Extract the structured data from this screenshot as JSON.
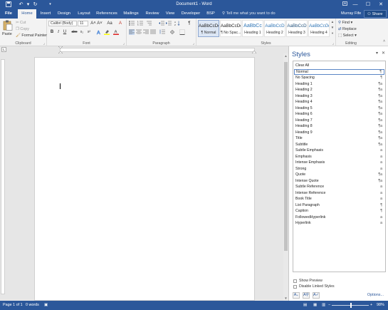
{
  "titlebar": {
    "title": "Document1 - Word",
    "save_icon": "save-icon",
    "undo_icon": "undo-icon",
    "redo_icon": "redo-icon",
    "customize_icon": "customize-qat-icon",
    "ribbon_display_icon": "ribbon-display-options-icon",
    "minimize": "—",
    "maximize": "☐",
    "close": "✕"
  },
  "tabs": {
    "file": "File",
    "items": [
      "Home",
      "Insert",
      "Design",
      "Layout",
      "References",
      "Mailings",
      "Review",
      "View",
      "Developer",
      "BSP"
    ],
    "active": "Home",
    "tell_me": "Tell me what you want to do",
    "user": "Murray Fife",
    "share": "Share"
  },
  "ribbon": {
    "clipboard": {
      "label": "Clipboard",
      "paste": "Paste",
      "cut": "Cut",
      "copy": "Copy",
      "format_painter": "Format Painter"
    },
    "font": {
      "label": "Font",
      "font_name": "Calibri (Body)",
      "font_size": "11",
      "bold": "B",
      "italic": "I",
      "underline": "U",
      "strike": "abc",
      "subscript": "x₂",
      "superscript": "x²",
      "grow": "A˄",
      "shrink": "A˅",
      "case": "Aa",
      "clear": "A"
    },
    "paragraph": {
      "label": "Paragraph"
    },
    "styles": {
      "label": "Styles",
      "gallery": [
        {
          "preview": "AaBbCcDc",
          "name": "¶ Normal",
          "selected": true
        },
        {
          "preview": "AaBbCcDc",
          "name": "¶ No Spac...",
          "selected": false
        },
        {
          "preview": "AaBbCc",
          "name": "Heading 1",
          "selected": false
        },
        {
          "preview": "AaBbCcD",
          "name": "Heading 2",
          "selected": false
        },
        {
          "preview": "AaBbCcD",
          "name": "Heading 3",
          "selected": false
        },
        {
          "preview": "AaBbCcDc",
          "name": "Heading 4",
          "selected": false
        }
      ]
    },
    "editing": {
      "label": "Editing",
      "find": "Find",
      "replace": "Replace",
      "select": "Select"
    }
  },
  "styles_pane": {
    "title": "Styles",
    "items": [
      {
        "name": "Clear All",
        "mark": ""
      },
      {
        "name": "Normal",
        "mark": "¶"
      },
      {
        "name": "No Spacing",
        "mark": "¶"
      },
      {
        "name": "Heading 1",
        "mark": "¶a"
      },
      {
        "name": "Heading 2",
        "mark": "¶a"
      },
      {
        "name": "Heading 3",
        "mark": "¶a"
      },
      {
        "name": "Heading 4",
        "mark": "¶a"
      },
      {
        "name": "Heading 5",
        "mark": "¶a"
      },
      {
        "name": "Heading 6",
        "mark": "¶a"
      },
      {
        "name": "Heading 7",
        "mark": "¶a"
      },
      {
        "name": "Heading 8",
        "mark": "¶a"
      },
      {
        "name": "Heading 9",
        "mark": "¶a"
      },
      {
        "name": "Title",
        "mark": "¶a"
      },
      {
        "name": "Subtitle",
        "mark": "¶a"
      },
      {
        "name": "Subtle Emphasis",
        "mark": "a"
      },
      {
        "name": "Emphasis",
        "mark": "a"
      },
      {
        "name": "Intense Emphasis",
        "mark": "a"
      },
      {
        "name": "Strong",
        "mark": "a"
      },
      {
        "name": "Quote",
        "mark": "¶a"
      },
      {
        "name": "Intense Quote",
        "mark": "¶a"
      },
      {
        "name": "Subtle Reference",
        "mark": "a"
      },
      {
        "name": "Intense Reference",
        "mark": "a"
      },
      {
        "name": "Book Title",
        "mark": "a"
      },
      {
        "name": "List Paragraph",
        "mark": "¶"
      },
      {
        "name": "Caption",
        "mark": "¶"
      },
      {
        "name": "FollowedHyperlink",
        "mark": "a"
      },
      {
        "name": "Hyperlink",
        "mark": "a"
      }
    ],
    "selected": "Normal",
    "show_preview": "Show Preview",
    "disable_linked": "Disable Linked Styles",
    "new_style_icon": "new-style-icon",
    "inspector_icon": "style-inspector-icon",
    "manage_icon": "manage-styles-icon",
    "options": "Options..."
  },
  "status": {
    "page": "Page 1 of 1",
    "words": "0 words",
    "proofing_icon": "proofing-icon",
    "zoom_minus": "−",
    "zoom_plus": "+",
    "zoom": "98%",
    "zoom_fraction": 0.5
  },
  "colors": {
    "accent": "#2b579a",
    "ribbon_bg": "#f3f3f3",
    "canvas_bg": "#e6e6e6"
  }
}
